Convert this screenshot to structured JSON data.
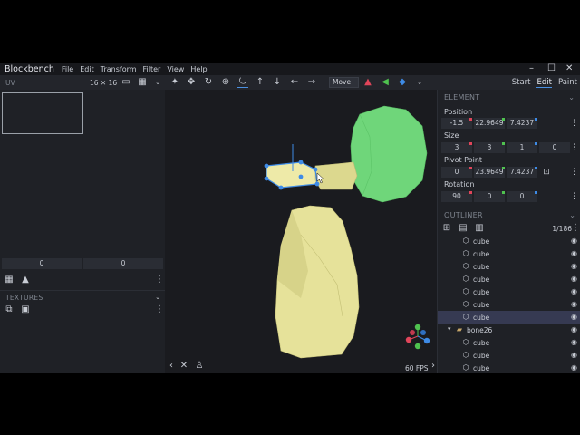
{
  "app": {
    "title": "Blockbench"
  },
  "menu": [
    "File",
    "Edit",
    "Transform",
    "Filter",
    "View",
    "Help"
  ],
  "window_controls": {
    "minimize": "–",
    "maximize": "☐",
    "close": "✕"
  },
  "uv_panel": {
    "label": "UV",
    "size": "16 ✕ 16",
    "inputs": [
      "0",
      "0"
    ]
  },
  "toolbar": {
    "transform_mode": "Move ⌄"
  },
  "mode_tabs": [
    "Start",
    "Edit",
    "Paint"
  ],
  "textures": {
    "label": "TEXTURES"
  },
  "element": {
    "title": "ELEMENT",
    "position": {
      "label": "Position",
      "values": [
        "-1.5",
        "22.9649",
        "7.4237"
      ]
    },
    "size": {
      "label": "Size",
      "values": [
        "3",
        "3",
        "1",
        "0"
      ]
    },
    "pivot": {
      "label": "Pivot Point",
      "values": [
        "0",
        "23.9649",
        "7.4237"
      ]
    },
    "rotation": {
      "label": "Rotation",
      "values": [
        "90",
        "0",
        "0"
      ]
    }
  },
  "outliner": {
    "title": "OUTLINER",
    "count": "1/186",
    "rows": [
      {
        "label": "cube",
        "type": "cube",
        "selected": false
      },
      {
        "label": "cube",
        "type": "cube",
        "selected": false
      },
      {
        "label": "cube",
        "type": "cube",
        "selected": false
      },
      {
        "label": "cube",
        "type": "cube",
        "selected": false
      },
      {
        "label": "cube",
        "type": "cube",
        "selected": false
      },
      {
        "label": "cube",
        "type": "cube",
        "selected": false
      },
      {
        "label": "cube",
        "type": "cube",
        "selected": true
      },
      {
        "label": "bone26",
        "type": "group",
        "selected": false
      },
      {
        "label": "cube",
        "type": "cube",
        "selected": false
      },
      {
        "label": "cube",
        "type": "cube",
        "selected": false
      },
      {
        "label": "cube",
        "type": "cube",
        "selected": false
      }
    ]
  },
  "viewport": {
    "fps": "60 FPS"
  },
  "colors": {
    "accent": "#4a90e2",
    "model_yellow": "#e6e29a",
    "model_green": "#6fd67a",
    "selected_row": "#363a52",
    "axis_x": "#e0455a",
    "axis_y": "#4fc24f",
    "axis_z": "#3e8be6"
  }
}
